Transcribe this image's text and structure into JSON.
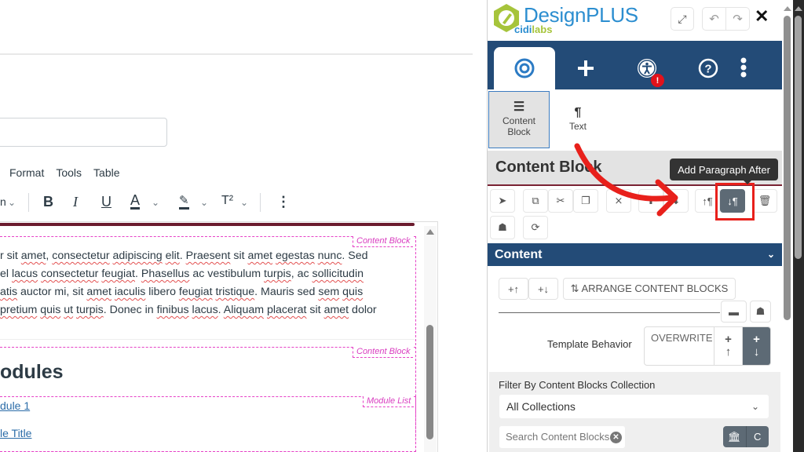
{
  "editor": {
    "menu": [
      "Format",
      "Tools",
      "Table"
    ],
    "toolbar": {
      "partial_dropdown": "n",
      "bold": "B",
      "italic": "I",
      "underline": "U",
      "text_color": "A",
      "highlight": "✎",
      "superscript": "T²",
      "more": "⋮",
      "chevron": "⌄"
    },
    "content_block_label": "Content Block",
    "module_list_label": "Module List",
    "paragraph_lines": [
      [
        "r sit ",
        {
          "s": "amet"
        },
        ", ",
        {
          "s": "consectetur"
        },
        " ",
        {
          "s": "adipiscing"
        },
        " ",
        {
          "s": "elit"
        },
        ". ",
        {
          "s": "Praesent"
        },
        " sit ",
        {
          "s": "amet"
        },
        " ",
        {
          "s": "egestas"
        },
        " ",
        {
          "s": "nunc"
        },
        ". Sed"
      ],
      [
        "el ",
        {
          "s": "lacus"
        },
        " ",
        {
          "s": "consectetur"
        },
        " ",
        {
          "s": "feugiat"
        },
        ". ",
        {
          "s": "Phasellus"
        },
        " ac vestibulum ",
        {
          "s": "turpis"
        },
        ", ac ",
        {
          "s": "sollicitudin"
        }
      ],
      [
        {
          "s": "atis"
        },
        " auctor mi, sit ",
        {
          "s": "amet"
        },
        " ",
        {
          "s": "iaculis"
        },
        " libero ",
        {
          "s": "feugiat"
        },
        " ",
        {
          "s": "tristique"
        },
        ". Mauris sed ",
        {
          "s": "sem"
        },
        " ",
        {
          "s": "quis"
        }
      ],
      [
        {
          "s": "pretium"
        },
        " ",
        {
          "s": "quis"
        },
        " ",
        {
          "s": "ut"
        },
        " ",
        {
          "s": "turpis"
        },
        ". Donec in ",
        {
          "s": "finibus"
        },
        " ",
        {
          "s": "lacus"
        },
        ". ",
        {
          "s": "Aliquam"
        },
        " ",
        {
          "s": "placerat"
        },
        " sit ",
        {
          "s": "amet"
        },
        " dolor"
      ]
    ],
    "heading": "odules",
    "module_links": [
      "dule 1",
      "le Title"
    ]
  },
  "panel": {
    "brand": "DesignPLUS",
    "brand_sub_a": "cidi",
    "brand_sub_b": "labs",
    "header_buttons": {
      "expand": "⤢",
      "undo": "↶",
      "redo": "↷",
      "close": "✕"
    },
    "tabs": [
      {
        "name": "tab-target",
        "icon": "target-icon",
        "active": true
      },
      {
        "name": "tab-add",
        "icon": "plus-icon"
      },
      {
        "name": "tab-accessibility",
        "icon": "accessibility-icon",
        "badge": "!"
      },
      {
        "name": "tab-help",
        "icon": "help-icon"
      },
      {
        "name": "tab-more",
        "icon": "more-vertical-icon"
      }
    ],
    "subtabs": [
      {
        "label_1": "Content",
        "label_2": "Block",
        "icon": "☰",
        "active": true
      },
      {
        "label_1": "Text",
        "icon": "¶"
      }
    ],
    "section_title": "Content Block",
    "tooltip": "Add Paragraph After",
    "tool_buttons": [
      {
        "name": "select",
        "glyph": "➤"
      },
      {
        "name": "copy",
        "glyph": "⧉"
      },
      {
        "name": "cut",
        "glyph": "✂"
      },
      {
        "name": "duplicate",
        "glyph": "❐"
      },
      {
        "name": "remove-styles",
        "glyph": "⨯"
      },
      {
        "name": "move-up",
        "glyph": "⬆"
      },
      {
        "name": "move-down",
        "glyph": "⬇"
      },
      {
        "name": "add-paragraph-before",
        "glyph": "↑¶"
      },
      {
        "name": "add-paragraph-after",
        "glyph": "↓¶",
        "active": true
      },
      {
        "name": "delete",
        "glyph": "🗑"
      },
      {
        "name": "ghost",
        "glyph": "☗"
      },
      {
        "name": "refresh",
        "glyph": "⟳"
      }
    ],
    "content_section": {
      "title": "Content",
      "chevron": "⌄",
      "insert_before": "+↑",
      "insert_after": "+↓",
      "arrange": "⇅ ARRANGE CONTENT BLOCKS",
      "box_icon": "▬",
      "ghost_icon": "☗",
      "template_behavior_label": "Template Behavior",
      "template_options": [
        "OVERWRITE",
        "+\n↑",
        "+\n↓"
      ],
      "template_selected": "append-after",
      "filter_label": "Filter By Content Blocks Collection",
      "collection_value": "All Collections",
      "search_placeholder": "Search Content Blocks",
      "institution_icon": "🏛",
      "course_icon": "C"
    }
  },
  "annotation": {
    "color": "#e8201b"
  }
}
